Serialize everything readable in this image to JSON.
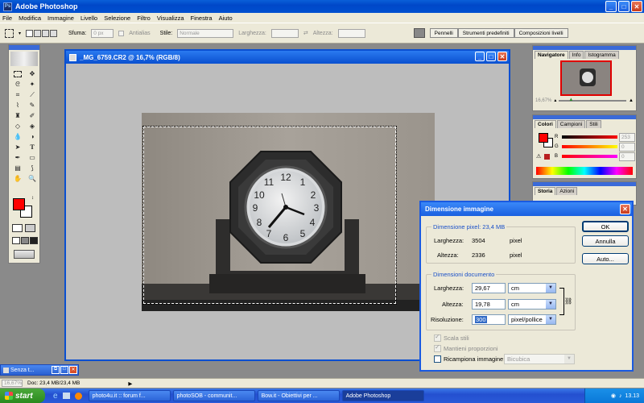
{
  "app": {
    "title": "Adobe Photoshop",
    "icon": "ps-icon"
  },
  "menu": [
    "File",
    "Modifica",
    "Immagine",
    "Livello",
    "Selezione",
    "Filtro",
    "Visualizza",
    "Finestra",
    "Aiuto"
  ],
  "options": {
    "sfuma_label": "Sfuma:",
    "sfuma_value": "0 px",
    "antialias_label": "Antialias",
    "stile_label": "Stile:",
    "stile_value": "Normale",
    "larghezza_label": "Larghezza:",
    "altezza_label": "Altezza:",
    "palette_tabs": [
      "Pennelli",
      "Strumenti predefiniti",
      "Composizioni livelli"
    ]
  },
  "document": {
    "title": "_MG_6759.CR2 @ 16,7% (RGB/8)"
  },
  "navigator": {
    "tabs": [
      "Navigatore",
      "Info",
      "Istogramma"
    ],
    "zoom": "16,67%"
  },
  "color_palette": {
    "tabs": [
      "Colori",
      "Campioni",
      "Stili"
    ],
    "channels": [
      {
        "label": "R",
        "value": "253",
        "color": "#e00000"
      },
      {
        "label": "G",
        "value": "0",
        "color": "#00a000"
      },
      {
        "label": "B",
        "value": "0",
        "color": "#0000e0"
      }
    ]
  },
  "history": {
    "tabs": [
      "Storia",
      "Azioni"
    ]
  },
  "minimized_doc": {
    "title": "Senza t..."
  },
  "statusbar": {
    "zoom": "16,67%",
    "doc": "Doc: 23,4 MB/23,4 MB"
  },
  "dialog": {
    "title": "Dimensione immagine",
    "pixel_group": "Dimensione pixel: 23,4 MB",
    "pixel_rows": [
      {
        "label": "Larghezza:",
        "value": "3504",
        "unit": "pixel"
      },
      {
        "label": "Altezza:",
        "value": "2336",
        "unit": "pixel"
      }
    ],
    "doc_group": "Dimensioni documento",
    "doc_rows": [
      {
        "label": "Larghezza:",
        "value": "29,67",
        "unit": "cm"
      },
      {
        "label": "Altezza:",
        "value": "19,78",
        "unit": "cm"
      },
      {
        "label": "Risoluzione:",
        "value": "300",
        "unit": "pixel/pollice"
      }
    ],
    "ok": "OK",
    "cancel": "Annulla",
    "auto": "Auto...",
    "scala_stili": "Scala stili",
    "mantieni": "Mantieni proporzioni",
    "ricampiona": "Ricampiona immagine:",
    "ricampiona_method": "Bicubica"
  },
  "taskbar": {
    "start": "start",
    "items": [
      "photo4u.it :: forum f...",
      "photoSOB - communit...",
      "Bow.it - Obiettivi per ...",
      "Adobe Photoshop"
    ],
    "clock": "13.13"
  },
  "colors": {
    "foreground": "#ff0000",
    "background": "#ffffff",
    "accent": "#0a50d0"
  }
}
